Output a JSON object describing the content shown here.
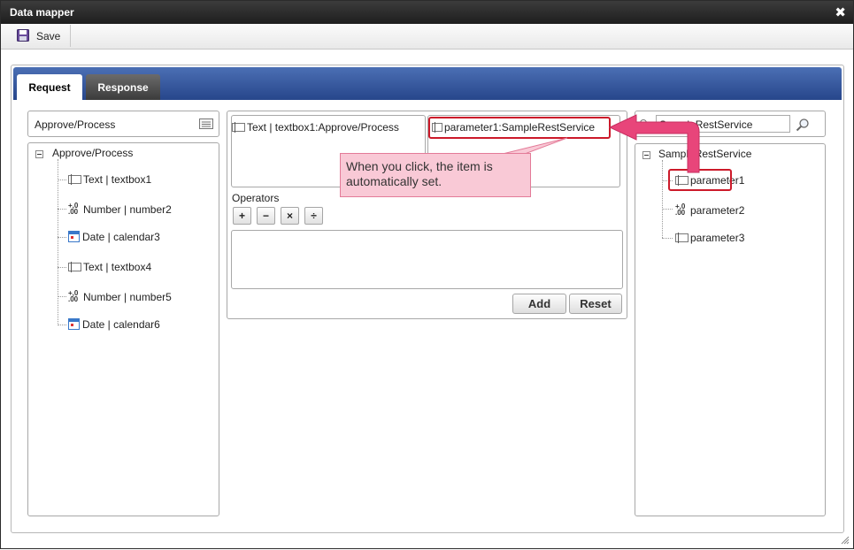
{
  "window": {
    "title": "Data mapper"
  },
  "toolbar": {
    "save_label": "Save"
  },
  "tabs": [
    {
      "label": "Request",
      "active": true
    },
    {
      "label": "Response",
      "active": false
    }
  ],
  "left": {
    "selector_value": "Approve/Process",
    "root": "Approve/Process",
    "items": [
      {
        "type": "text",
        "label": "Text | textbox1"
      },
      {
        "type": "number",
        "label": "Number | number2"
      },
      {
        "type": "date",
        "label": "Date | calendar3"
      },
      {
        "type": "text",
        "label": "Text | textbox4"
      },
      {
        "type": "number",
        "label": "Number | number5"
      },
      {
        "type": "date",
        "label": "Date | calendar6"
      }
    ]
  },
  "middle": {
    "source_item": "Text | textbox1:Approve/Process",
    "target_item": "parameter1:SampleRestService",
    "operators_label": "Operators",
    "operators": [
      "+",
      "−",
      "×",
      "÷"
    ],
    "expression": "",
    "add_label": "Add",
    "reset_label": "Reset"
  },
  "right": {
    "search_value": "SampleRestService",
    "root": "SampleRestService",
    "items": [
      {
        "type": "text",
        "label": "parameter1"
      },
      {
        "type": "number",
        "label": "parameter2"
      },
      {
        "type": "text",
        "label": "parameter3"
      }
    ]
  },
  "callout": {
    "text": "When you click, the item is automatically set."
  },
  "colors": {
    "highlight": "#cc1a2a",
    "callout_bg": "#f9c9d6",
    "arrow": "#e8457a",
    "tabbar": "#27468b"
  }
}
